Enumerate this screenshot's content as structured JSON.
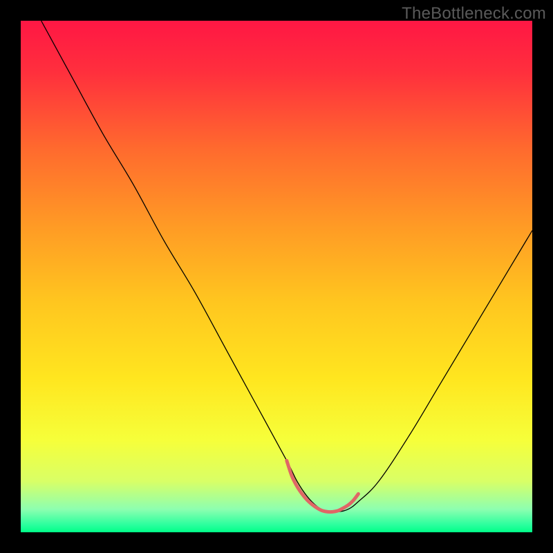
{
  "watermark": "TheBottleneck.com",
  "chart_data": {
    "type": "line",
    "title": "",
    "xlabel": "",
    "ylabel": "",
    "xlim": [
      0,
      100
    ],
    "ylim": [
      0,
      100
    ],
    "legend": false,
    "grid": false,
    "background_gradient_stops": [
      {
        "offset": 0.0,
        "color": "#ff1744"
      },
      {
        "offset": 0.1,
        "color": "#ff2f3d"
      },
      {
        "offset": 0.25,
        "color": "#ff6a2e"
      },
      {
        "offset": 0.4,
        "color": "#ff9a25"
      },
      {
        "offset": 0.55,
        "color": "#ffc61f"
      },
      {
        "offset": 0.7,
        "color": "#ffe61f"
      },
      {
        "offset": 0.82,
        "color": "#f6ff3a"
      },
      {
        "offset": 0.9,
        "color": "#d9ff66"
      },
      {
        "offset": 0.955,
        "color": "#8dffb0"
      },
      {
        "offset": 0.985,
        "color": "#2cff9e"
      },
      {
        "offset": 1.0,
        "color": "#00ff88"
      }
    ],
    "series": [
      {
        "name": "bottleneck-curve",
        "stroke": "#000000",
        "stroke_width": 1.3,
        "x": [
          4,
          10,
          16,
          22,
          28,
          34,
          40,
          46,
          52,
          54,
          56,
          58,
          60,
          62,
          64,
          66,
          70,
          76,
          82,
          88,
          94,
          100
        ],
        "y": [
          100,
          89,
          78,
          68,
          57,
          47,
          36,
          25,
          14,
          10,
          7,
          5,
          4,
          4,
          4.5,
          6,
          10,
          19,
          29,
          39,
          49,
          59
        ]
      },
      {
        "name": "optimal-band-marker",
        "stroke": "#e06666",
        "stroke_width": 5,
        "x": [
          52,
          53,
          54,
          55,
          56,
          57,
          58,
          59,
          60,
          61,
          62,
          63,
          64,
          65,
          66
        ],
        "y": [
          14,
          11,
          9,
          7.5,
          6.3,
          5.4,
          4.7,
          4.2,
          4,
          4,
          4.2,
          4.7,
          5.3,
          6.2,
          7.5
        ]
      }
    ]
  }
}
